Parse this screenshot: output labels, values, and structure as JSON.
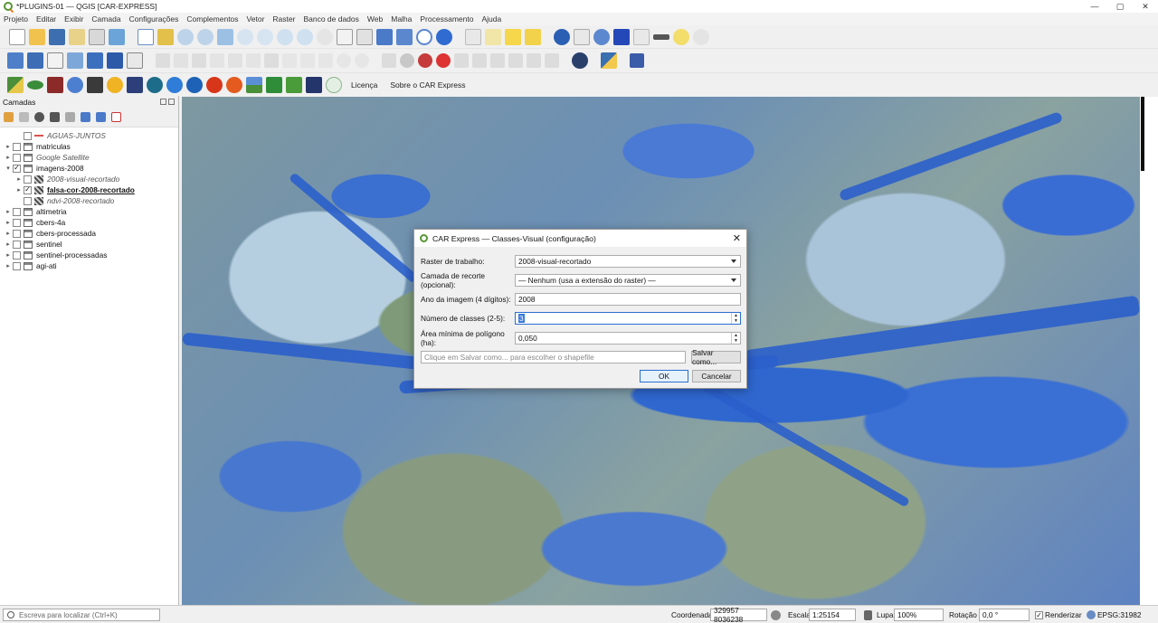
{
  "window": {
    "title": "*PLUGINS-01 — QGIS [CAR-EXPRESS]",
    "minimize": "—",
    "maximize": "▢",
    "close": "✕"
  },
  "menu": [
    "Projeto",
    "Editar",
    "Exibir",
    "Camada",
    "Configurações",
    "Complementos",
    "Vetor",
    "Raster",
    "Banco de dados",
    "Web",
    "Malha",
    "Processamento",
    "Ajuda"
  ],
  "plugin_toolbar": {
    "licenca": "Licença",
    "sobre": "Sobre o CAR Express"
  },
  "layers_panel": {
    "title": "Camadas",
    "items": [
      {
        "name": "AGUAS-JUNTOS",
        "checked": false,
        "style": "italic",
        "icon": "line-layer-icon",
        "indent": 1,
        "expander": ""
      },
      {
        "name": "matriculas",
        "checked": false,
        "style": "normal",
        "icon": "group-icon",
        "indent": 0,
        "expander": "▸"
      },
      {
        "name": "Google Satellite",
        "checked": false,
        "style": "italic",
        "icon": "group-icon",
        "indent": 0,
        "expander": "▸"
      },
      {
        "name": "imagens-2008",
        "checked": true,
        "style": "normal",
        "icon": "group-icon",
        "indent": 0,
        "expander": "▾"
      },
      {
        "name": "2008-visual-recortado",
        "checked": false,
        "style": "italic",
        "icon": "raster-icon",
        "indent": 1,
        "expander": "▸"
      },
      {
        "name": "falsa-cor-2008-recortado",
        "checked": true,
        "style": "bold",
        "icon": "raster-icon",
        "indent": 1,
        "expander": "▸"
      },
      {
        "name": "ndvi-2008-recortado",
        "checked": false,
        "style": "italic",
        "icon": "raster-icon",
        "indent": 1,
        "expander": ""
      },
      {
        "name": "altimetria",
        "checked": false,
        "style": "normal",
        "icon": "group-icon",
        "indent": 0,
        "expander": "▸"
      },
      {
        "name": "cbers-4a",
        "checked": false,
        "style": "normal",
        "icon": "group-icon",
        "indent": 0,
        "expander": "▸"
      },
      {
        "name": "cbers-processada",
        "checked": false,
        "style": "normal",
        "icon": "group-icon",
        "indent": 0,
        "expander": "▸"
      },
      {
        "name": "sentinel",
        "checked": false,
        "style": "normal",
        "icon": "group-icon",
        "indent": 0,
        "expander": "▸"
      },
      {
        "name": "sentinel-processadas",
        "checked": false,
        "style": "normal",
        "icon": "group-icon",
        "indent": 0,
        "expander": "▸"
      },
      {
        "name": "agi-ati",
        "checked": false,
        "style": "normal",
        "icon": "group-icon",
        "indent": 0,
        "expander": "▸"
      }
    ]
  },
  "dialog": {
    "title": "CAR Express — Classes-Visual (configuração)",
    "close": "✕",
    "raster_label": "Raster de trabalho:",
    "raster_value": "2008-visual-recortado",
    "clip_label": "Camada de recorte (opcional):",
    "clip_value": "— Nenhum (usa a extensão do raster) —",
    "year_label": "Ano da imagem (4 dígitos):",
    "year_value": "2008",
    "classes_label": "Número de classes (2-5):",
    "classes_value": "3",
    "area_label": "Área mínima de polígono (ha):",
    "area_value": "0,050",
    "output_placeholder": "Clique em Salvar como... para escolher o shapefile",
    "save_as": "Salvar como...",
    "ok": "OK",
    "cancel": "Cancelar"
  },
  "statusbar": {
    "locator_placeholder": "Escreva para localizar (Ctrl+K)",
    "coord_label": "Coordenada",
    "coord_value": "329957  8036238",
    "scale_label": "Escala",
    "scale_value": "1:25154",
    "magnifier_label": "Lupa",
    "magnifier_value": "100%",
    "rotation_label": "Rotação",
    "rotation_value": "0,0 °",
    "render_label": "Renderizar",
    "crs": "EPSG:31982"
  },
  "colors": {
    "qgis_green": "#589632",
    "qgis_orange": "#ee7913",
    "focus_blue": "#2a6fd0"
  }
}
